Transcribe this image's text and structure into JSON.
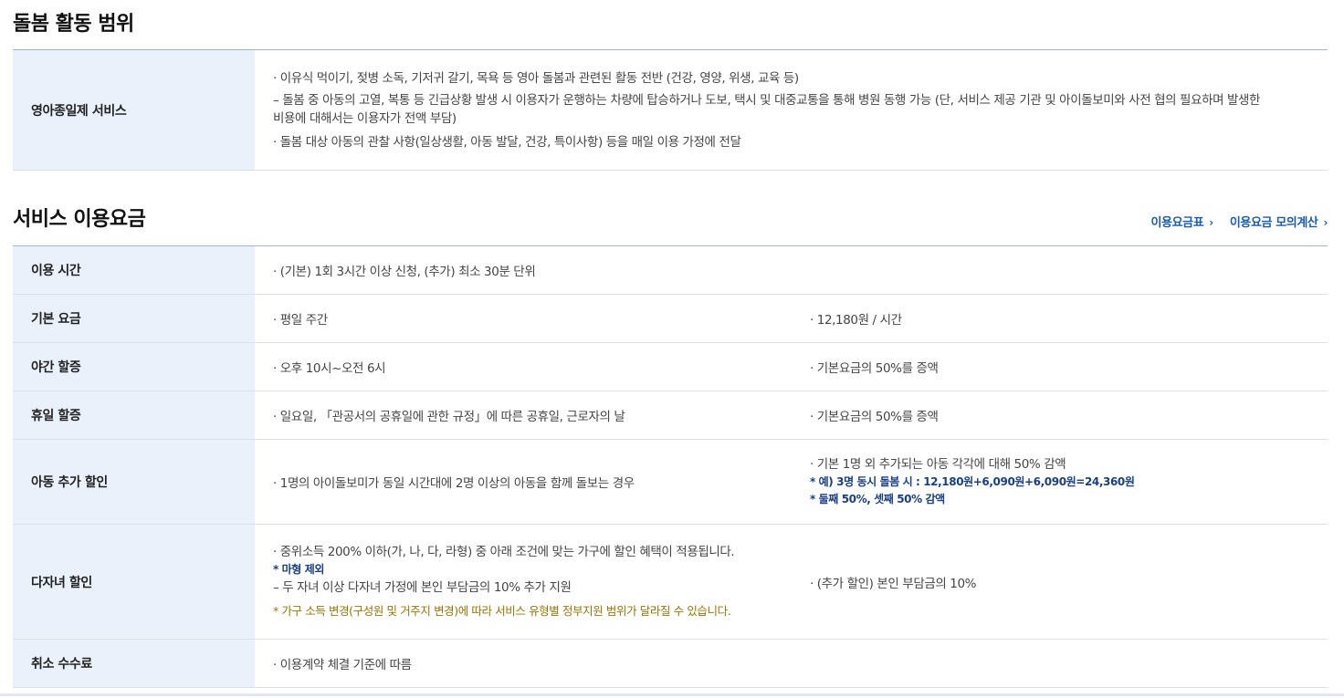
{
  "section1": {
    "title": "돌봄 활동 범위",
    "row": {
      "label": "영아종일제 서비스",
      "lines": [
        "· 이유식 먹이기, 젖병 소독, 기저귀 갈기, 목욕 등 영아 돌봄과 관련된 활동 전반 (건강, 영양, 위생, 교육 등)",
        "– 돌봄 중 아동의 고열, 복통 등 긴급상황 발생 시 이용자가 운행하는 차량에 탑승하거나 도보, 택시 및 대중교통을 통해 병원 동행 가능 (단, 서비스 제공 기관 및 아이돌보미와 사전 협의 필요하며 발생한 비용에 대해서는 이용자가 전액 부담)",
        "· 돌봄 대상 아동의 관찰 사항(일상생활, 아동 발달, 건강, 특이사항) 등을 매일 이용 가정에 전달"
      ]
    }
  },
  "section2": {
    "title": "서비스 이용요금",
    "links": [
      "이용요금표",
      "이용요금 모의계산"
    ],
    "rows": [
      {
        "label": "이용 시간",
        "value": "· (기본) 1회 3시간 이상 신청, (추가) 최소 30분 단위"
      },
      {
        "label": "기본 요금",
        "value": "· 평일 주간",
        "value2": "· 12,180원 / 시간"
      },
      {
        "label": "야간 할증",
        "value": "· 오후 10시~오전 6시",
        "value2": "· 기본요금의 50%를 증액"
      },
      {
        "label": "휴일 할증",
        "value": "· 일요일, 「관공서의 공휴일에 관한 규정」에 따른 공휴일, 근로자의 날",
        "value2": "· 기본요금의 50%를 증액"
      },
      {
        "label": "아동 추가 할인",
        "value": "· 1명의 아이돌보미가 동일 시간대에 2명 이상의 아동을 함께 돌보는 경우",
        "value2": "· 기본 1명 외 추가되는 아동 각각에 대해 50% 감액",
        "note1": "* 예) 3명 동시 돌봄 시 : 12,180원+6,090원+6,090원=24,360원",
        "note2": "* 둘째 50%, 셋째 50% 감액"
      },
      {
        "label": "다자녀 할인",
        "value": "· 중위소득 200% 이하(가, 나, 다, 라형) 중 아래 조건에 맞는 가구에 할인 혜택이 적용됩니다.",
        "note": "* 마형 제외",
        "sub": "– 두 자녀 이상 다자녀 가정에 본인 부담금의 10% 추가 지원",
        "warn": "* 가구 소득 변경(구성원 및 거주지 변경)에 따라 서비스 유형별 정부지원 범위가 달라질 수 있습니다.",
        "value2": "· (추가 할인) 본인 부담금의 10%"
      },
      {
        "label": "취소 수수료",
        "value": "· 이용계약 체결 기준에 따름"
      }
    ]
  },
  "colors": {
    "accent": "#1a5bb5",
    "header_bg": "#eaf1fb",
    "note": "#1a3f85",
    "warn": "#9a7400"
  }
}
